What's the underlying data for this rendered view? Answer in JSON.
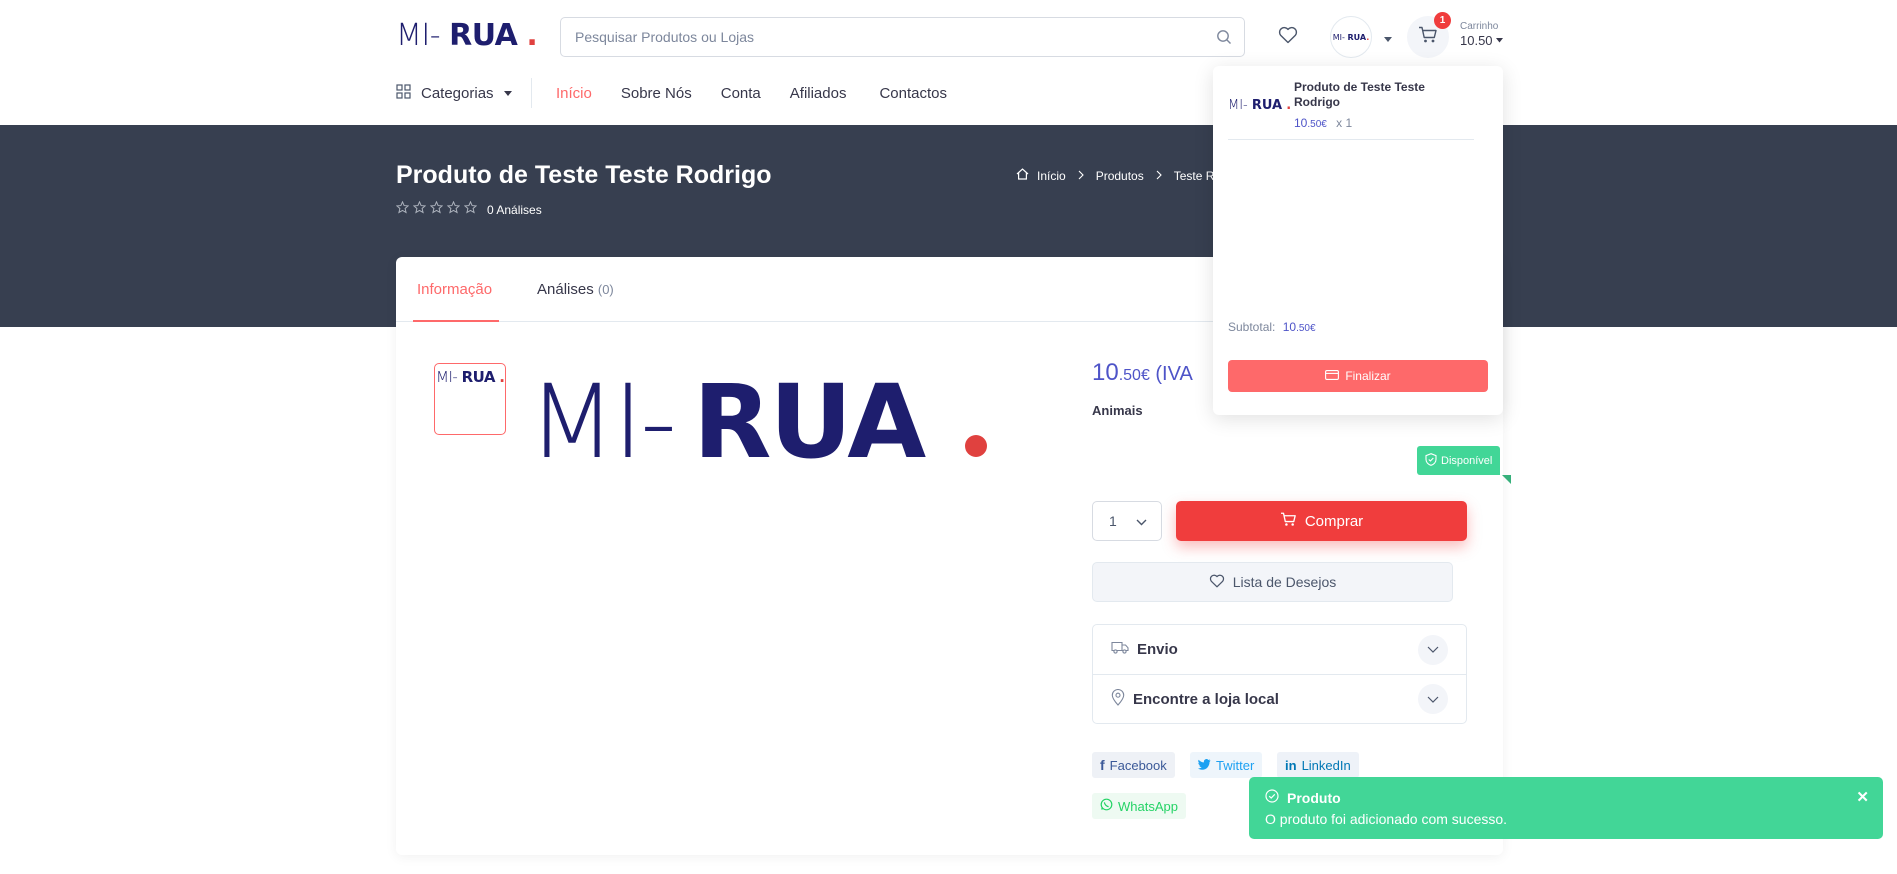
{
  "header": {
    "logo": {
      "mi": "MI-",
      "rua": "RUA",
      "dot": "."
    },
    "search_placeholder": "Pesquisar Produtos ou Lojas",
    "cart": {
      "count": "1",
      "label": "Carrinho",
      "total": "10.50"
    },
    "avatar_logo": {
      "mi": "MI-",
      "rua": "RUA",
      "dot": "."
    }
  },
  "nav": {
    "categories": "Categorias",
    "items": [
      "Início",
      "Sobre Nós",
      "Conta",
      "Afiliados",
      "Contactos"
    ]
  },
  "hero": {
    "title": "Produto de Teste Teste Rodrigo",
    "reviews": "0 Análises",
    "breadcrumb": [
      "Início",
      "Produtos",
      "Teste Ro"
    ]
  },
  "tabs": {
    "info": "Informação",
    "reviews": "Análises",
    "reviews_count": "(0)"
  },
  "product": {
    "price_int": "10",
    "price_dec": ".50€",
    "price_suffix": " (IVA",
    "category": "Animais",
    "availability": "Disponível",
    "quantity": "1",
    "buy": "Comprar",
    "wishlist": "Lista de Desejos",
    "accordion": [
      "Envio",
      "Encontre a loja local"
    ],
    "share": [
      "Facebook",
      "Twitter",
      "LinkedIn",
      "WhatsApp"
    ],
    "image_logo": {
      "mi": "MI-",
      "rua": "RUA",
      "dot": "."
    }
  },
  "dropdown": {
    "item_name": "Produto de Teste Teste Rodrigo",
    "item_price_int": "10",
    "item_price_dec": ".50€",
    "item_qty": "x 1",
    "subtotal_label": "Subtotal:",
    "subtotal_int": "10",
    "subtotal_dec": ".50€",
    "checkout": "Finalizar",
    "thumb_logo": {
      "mi": "MI-",
      "rua": "RUA",
      "dot": "."
    }
  },
  "toast": {
    "title": "Produto",
    "message": "O produto foi adicionado com sucesso.",
    "close": "✕"
  },
  "colors": {
    "brand_navy": "#1e1e6e",
    "accent_red": "#f03d3d",
    "accent_coral": "#fe696a",
    "success_green": "#42d697",
    "hero_bg": "#373f50",
    "price_blue": "#4e54c8"
  },
  "icons": [
    "search-icon",
    "heart-icon",
    "cart-icon",
    "caret-down-icon",
    "grid-icon",
    "home-icon",
    "chevron-right-icon",
    "star-icon",
    "truck-icon",
    "map-pin-icon",
    "chevron-down-icon",
    "facebook-icon",
    "twitter-icon",
    "linkedin-icon",
    "whatsapp-icon",
    "credit-card-icon",
    "shield-check-icon",
    "check-circle-icon",
    "close-icon"
  ]
}
